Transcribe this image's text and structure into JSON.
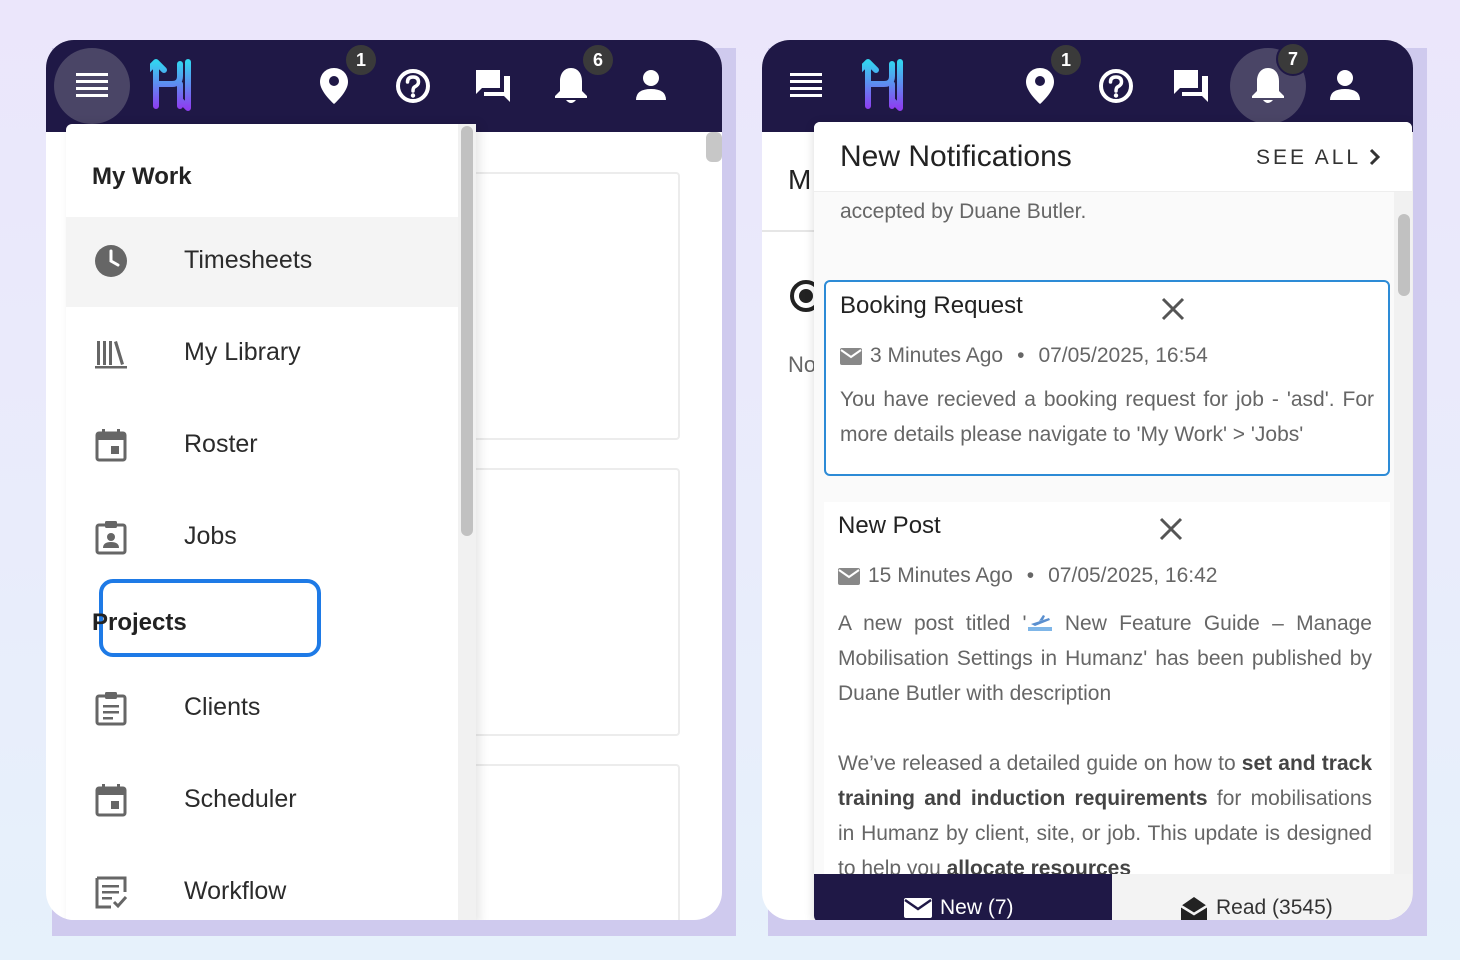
{
  "left_screen": {
    "badges": {
      "location": "1",
      "notifications": "6"
    },
    "sections": [
      {
        "title": "My Work"
      },
      {
        "title": "Projects"
      }
    ],
    "menu": [
      {
        "label": "Timesheets",
        "icon": "clock-icon",
        "active": true
      },
      {
        "label": "My Library",
        "icon": "library-icon"
      },
      {
        "label": "Roster",
        "icon": "calendar-icon"
      },
      {
        "label": "Jobs",
        "icon": "badge-clipboard-icon",
        "highlighted": true
      },
      {
        "label": "Clients",
        "icon": "clipboard-icon"
      },
      {
        "label": "Scheduler",
        "icon": "calendar-icon"
      },
      {
        "label": "Workflow",
        "icon": "checklist-icon"
      }
    ]
  },
  "right_screen": {
    "badges": {
      "location": "1",
      "notifications": "7"
    },
    "behind": {
      "m_text": "M",
      "no_text": "No"
    },
    "panel": {
      "title": "New Notifications",
      "see_all": "SEE ALL",
      "previous_snippet": "accepted by Duane Butler.",
      "cards": [
        {
          "title": "Booking Request",
          "time_ago": "3 Minutes Ago",
          "datetime": "07/05/2025, 16:54",
          "body": "You have recieved a booking request for job - 'asd'. For more details please navigate to 'My Work' > 'Jobs'"
        },
        {
          "title": "New Post",
          "time_ago": "15 Minutes Ago",
          "datetime": "07/05/2025, 16:42",
          "body_prefix": "A new post titled '",
          "body_suffix": " New Feature Guide – Manage Mobilisation Settings in Humanz' has been published by Duane Butler with description",
          "body2_parts": [
            {
              "text": "We’ve released a detailed guide on how to ",
              "bold": false
            },
            {
              "text": "set and track training and induction requirements",
              "bold": true
            },
            {
              "text": " for mobilisations in Humanz by client, site, or job. This update is designed to help you ",
              "bold": false
            },
            {
              "text": "allocate resources",
              "bold": true
            }
          ]
        }
      ],
      "tabs": {
        "new": "New (7)",
        "read": "Read (3545)"
      }
    }
  },
  "colors": {
    "topbar": "#1f1846",
    "highlight": "#1e7ae6",
    "selected_card_border": "#2d8bd6"
  }
}
